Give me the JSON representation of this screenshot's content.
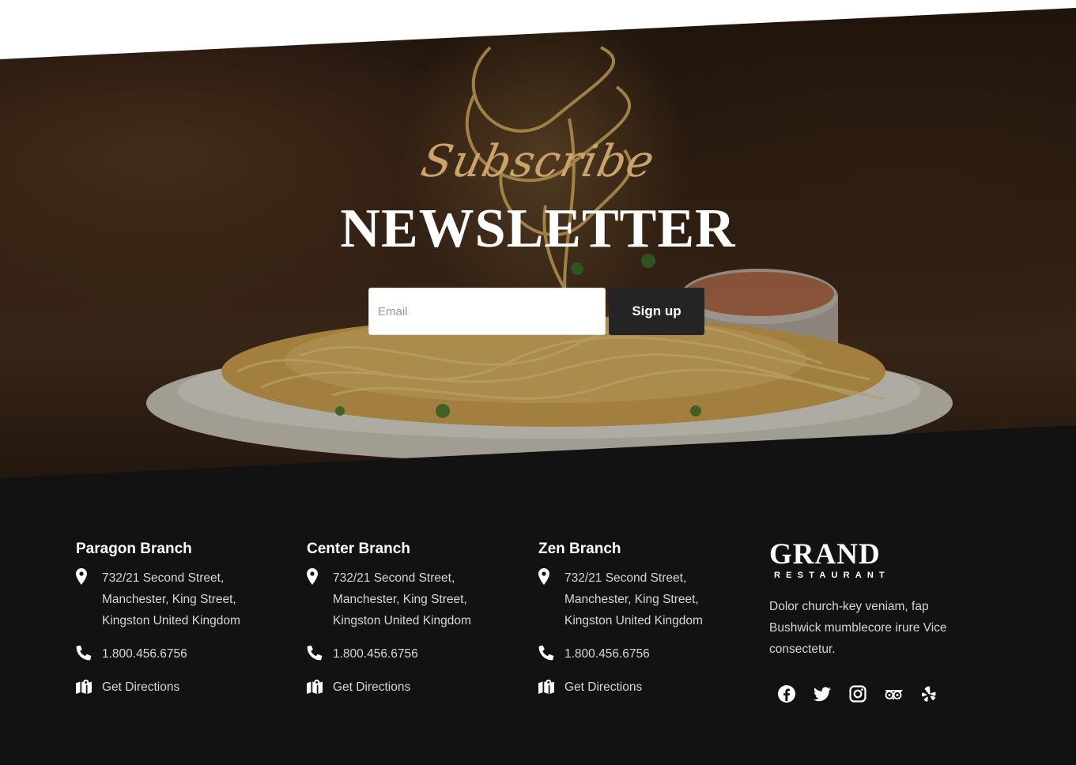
{
  "hero": {
    "script_title": "Subscribe",
    "title": "NEWSLETTER",
    "email_placeholder": "Email",
    "email_value": "",
    "signup_label": "Sign up"
  },
  "branches": [
    {
      "name": "Paragon Branch",
      "address_lines": [
        "732/21 Second Street,",
        "Manchester, King Street,",
        "Kingston United Kingdom"
      ],
      "phone": "1.800.456.6756",
      "directions_label": "Get Directions"
    },
    {
      "name": "Center Branch",
      "address_lines": [
        "732/21 Second Street,",
        "Manchester, King Street,",
        "Kingston United Kingdom"
      ],
      "phone": "1.800.456.6756",
      "directions_label": "Get Directions"
    },
    {
      "name": "Zen Branch",
      "address_lines": [
        "732/21 Second Street,",
        "Manchester, King Street,",
        "Kingston United Kingdom"
      ],
      "phone": "1.800.456.6756",
      "directions_label": "Get Directions"
    }
  ],
  "brand": {
    "logo_main": "GRAND",
    "logo_sub": "RESTAURANT",
    "about": "Dolor church-key veniam, fap Bushwick mumblecore irure Vice consectetur."
  },
  "social_icons": [
    "facebook-icon",
    "twitter-icon",
    "instagram-icon",
    "tripadvisor-icon",
    "yelp-icon"
  ],
  "colors": {
    "footer_bg": "#121212",
    "button_bg": "#242424",
    "script_gold": "#c9a36a",
    "text_light": "#d6d6d6"
  }
}
